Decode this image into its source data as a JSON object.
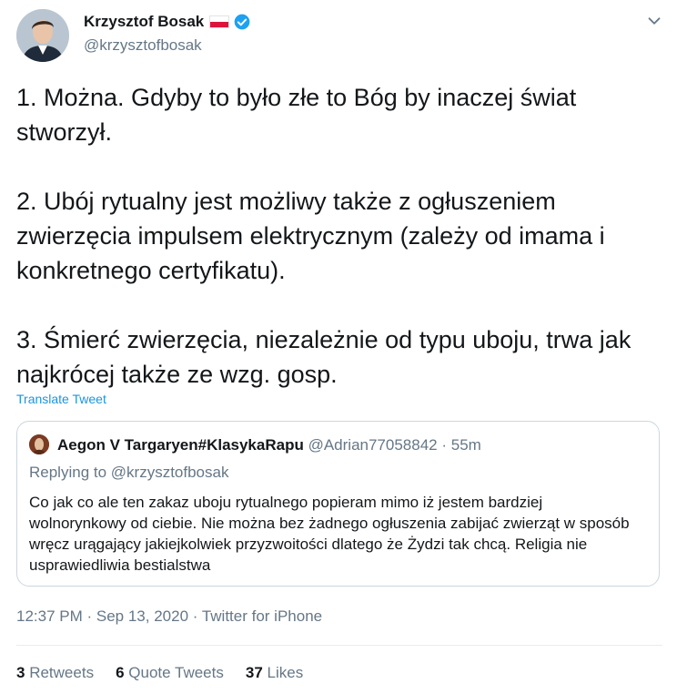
{
  "author": {
    "display_name": "Krzysztof Bosak",
    "handle": "@krzysztofbosak"
  },
  "tweet": {
    "paragraphs": [
      "1. Można. Gdyby to było złe to Bóg by inaczej świat stworzył.",
      "2. Ubój rytualny jest możliwy także z ogłuszeniem zwierzęcia impulsem elektrycznym (zależy od imama i konkretnego certyfikatu).",
      "3. Śmierć zwierzęcia, niezależnie od typu uboju, trwa jak najkrócej także ze wzg. gosp."
    ],
    "translate_label": "Translate Tweet",
    "timestamp": "12:37 PM · Sep 13, 2020 · Twitter for iPhone"
  },
  "quoted": {
    "display_name": "Aegon V Targaryen#KlasykaRapu",
    "handle": "@Adrian77058842",
    "time": "· 55m",
    "replying_to": "Replying to @krzysztofbosak",
    "text": "Co jak co ale ten zakaz uboju rytualnego popieram mimo iż jestem bardziej wolnorynkowy od ciebie. Nie można bez żadnego ogłuszenia zabijać zwierząt w sposób wręcz urągający jakiejkolwiek przyzwoitości dlatego że Żydzi tak chcą. Religia nie usprawiedliwia bestialstwa"
  },
  "stats": {
    "retweets_count": "3",
    "retweets_label": "Retweets",
    "quotes_count": "6",
    "quotes_label": "Quote Tweets",
    "likes_count": "37",
    "likes_label": "Likes"
  },
  "colors": {
    "accent": "#1b95e0",
    "secondary_text": "#657786",
    "primary_text": "#14171a",
    "border": "#ccd6dd"
  },
  "icons": [
    "polish-flag-icon",
    "verified-badge-icon",
    "chevron-down-icon"
  ]
}
